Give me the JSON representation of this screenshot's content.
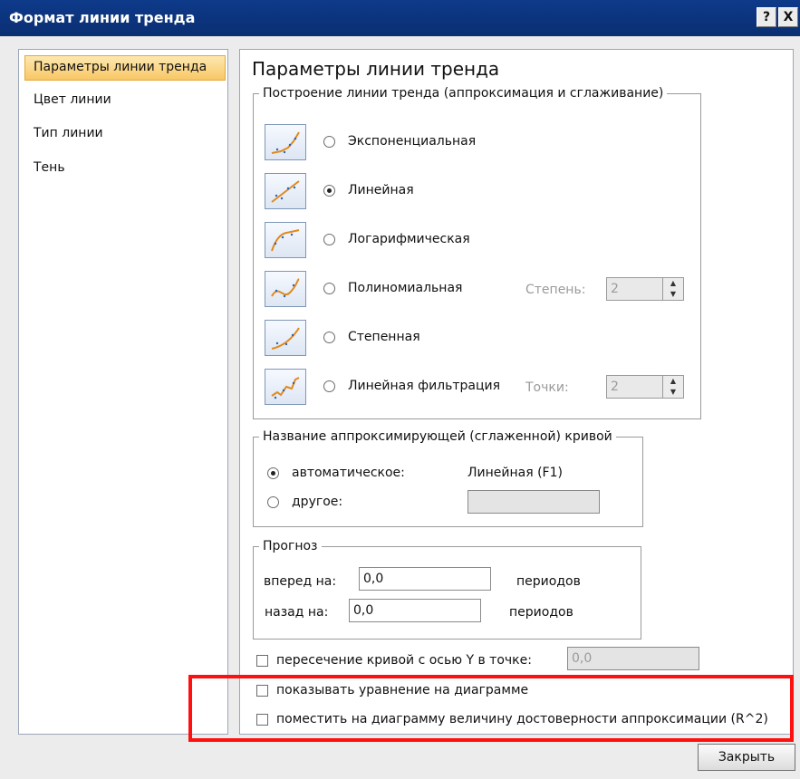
{
  "window": {
    "title": "Формат линии тренда",
    "help_label": "?",
    "close_label": "X"
  },
  "sidebar": {
    "items": [
      {
        "label": "Параметры линии тренда",
        "selected": true
      },
      {
        "label": "Цвет линии",
        "selected": false
      },
      {
        "label": "Тип линии",
        "selected": false
      },
      {
        "label": "Тень",
        "selected": false
      }
    ]
  },
  "main": {
    "heading": "Параметры линии тренда",
    "trend_group": {
      "legend": "Построение линии тренда (аппроксимация и сглаживание)",
      "options": [
        {
          "label": "Экспоненциальная",
          "selected": false,
          "icon": "exponential-trend-icon"
        },
        {
          "label": "Линейная",
          "selected": true,
          "icon": "linear-trend-icon"
        },
        {
          "label": "Логарифмическая",
          "selected": false,
          "icon": "logarithmic-trend-icon"
        },
        {
          "label": "Полиномиальная",
          "selected": false,
          "icon": "polynomial-trend-icon"
        },
        {
          "label": "Степенная",
          "selected": false,
          "icon": "power-trend-icon"
        },
        {
          "label": "Линейная фильтрация",
          "selected": false,
          "icon": "moving-average-icon"
        }
      ],
      "degree": {
        "label": "Степень:",
        "value": "2"
      },
      "points": {
        "label": "Точки:",
        "value": "2"
      }
    },
    "name_group": {
      "legend": "Название аппроксимирующей (сглаженной) кривой",
      "automatic_label": "автоматическое:",
      "automatic_value": "Линейная (F1)",
      "custom_label": "другое:",
      "custom_value": ""
    },
    "forecast_group": {
      "legend": "Прогноз",
      "forward_label": "вперед на:",
      "forward_value": "0,0",
      "forward_unit": "периодов",
      "backward_label": "назад на:",
      "backward_value": "0,0",
      "backward_unit": "периодов"
    },
    "intercept": {
      "label": "пересечение кривой с осью Y в точке:",
      "value": "0,0",
      "checked": false
    },
    "show_equation": {
      "label": "показывать уравнение на диаграмме",
      "checked": false
    },
    "show_r2": {
      "label": "поместить на диаграмму величину достоверности аппроксимации (R^2)",
      "checked": false
    }
  },
  "footer": {
    "close_label": "Закрыть"
  },
  "colors": {
    "titlebar": "#0e3a8a",
    "selection": "#f8c765",
    "highlight": "#ff1010"
  }
}
